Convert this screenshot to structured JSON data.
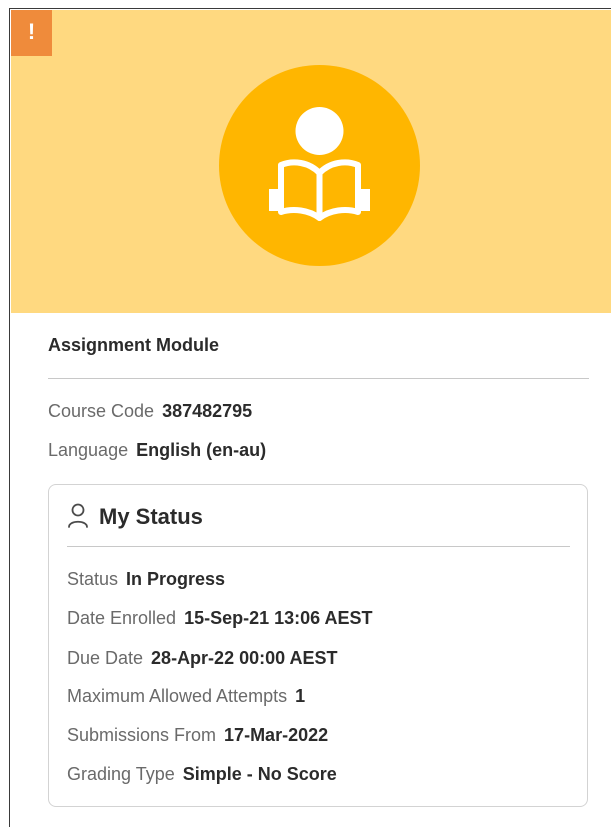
{
  "banner": {
    "alert_glyph": "!",
    "icon": "reading-book-icon",
    "colors": {
      "banner_bg": "#ffd980",
      "circle": "#ffb600",
      "alert_badge": "#ef8b3b"
    }
  },
  "module": {
    "title": "Assignment Module",
    "course_code_label": "Course Code",
    "course_code": "387482795",
    "language_label": "Language",
    "language": "English (en-au)"
  },
  "my_status": {
    "heading": "My Status",
    "icon": "person-icon",
    "fields": [
      {
        "label": "Status",
        "value": "In Progress"
      },
      {
        "label": "Date Enrolled",
        "value": "15-Sep-21 13:06 AEST"
      },
      {
        "label": "Due Date",
        "value": "28-Apr-22 00:00 AEST"
      },
      {
        "label": "Maximum Allowed Attempts",
        "value": "1"
      },
      {
        "label": "Submissions From",
        "value": "17-Mar-2022"
      },
      {
        "label": "Grading Type",
        "value": "Simple - No Score"
      }
    ]
  }
}
